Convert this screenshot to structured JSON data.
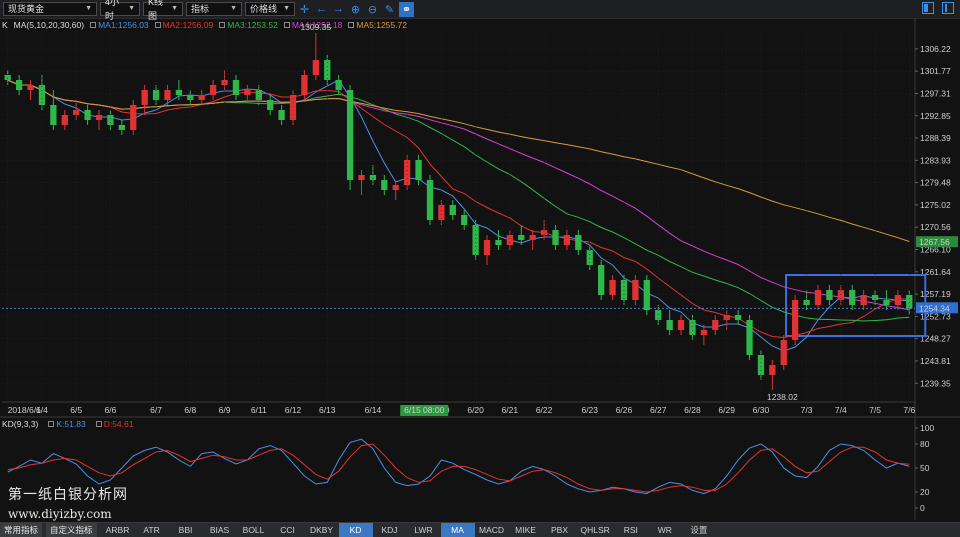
{
  "toolbar": {
    "symbol": "现货黄金",
    "period": "4小时",
    "chart_type": "K线图",
    "indicator": "指标",
    "drawing": "价格线",
    "icons": [
      "crosshair-icon",
      "arrow-left-icon",
      "arrow-right-icon",
      "zoom-in-icon",
      "zoom-out-icon",
      "pen-icon",
      "link-icon"
    ]
  },
  "ma_legend": {
    "mode": "K",
    "label": "MA(5,10,20,30,60)",
    "items": [
      {
        "text": "MA1:1256.03",
        "color": "#4b8fe8"
      },
      {
        "text": "MA2:1256.09",
        "color": "#e23333"
      },
      {
        "text": "MA3:1253.52",
        "color": "#2fb84a"
      },
      {
        "text": "MA4:1252.18",
        "color": "#d63fd6"
      },
      {
        "text": "MA5:1255.72",
        "color": "#d89a3c"
      }
    ]
  },
  "price_axis": {
    "ticks": [
      "1306.22",
      "1301.77",
      "1297.31",
      "1292.85",
      "1288.39",
      "1283.93",
      "1279.48",
      "1275.02",
      "1270.56",
      "1266.10",
      "1261.64",
      "1257.19",
      "1252.73",
      "1248.27",
      "1243.81",
      "1239.35"
    ],
    "last_price_label": "1254.34",
    "ma_price_label": "1267.56"
  },
  "annotations": {
    "high": "1309.35",
    "low": "1238.02",
    "time_cursor": "6/15 08:00"
  },
  "date_axis": [
    "2018/6/1",
    "6/4",
    "6/5",
    "6/6",
    "6/7",
    "6/8",
    "6/9",
    "6/11",
    "6/12",
    "6/13",
    "6/14",
    "6/1",
    "6/19",
    "6/20",
    "6/21",
    "6/22",
    "6/23",
    "6/26",
    "6/27",
    "6/28",
    "6/29",
    "6/30",
    "7/3",
    "7/4",
    "7/5",
    "7/6"
  ],
  "kd_legend": {
    "label": "KD(9,3,3)",
    "k": {
      "text": "K:51.83",
      "color": "#4b8fe8"
    },
    "d": {
      "text": "D:54.61",
      "color": "#e23333"
    }
  },
  "kd_axis": [
    "100",
    "80",
    "50",
    "20",
    "0"
  ],
  "tabs": [
    "常用指标",
    "自定义指标",
    "ARBR",
    "ATR",
    "BBI",
    "BIAS",
    "BOLL",
    "CCI",
    "DKBY",
    "KD",
    "KDJ",
    "LWR",
    "MA",
    "MACD",
    "MIKE",
    "PBX",
    "QHLSR",
    "RSI",
    "WR",
    "设置"
  ],
  "active_tabs": [
    "KD",
    "MA"
  ],
  "watermark": {
    "line1": "第一纸白银分析网",
    "line2": "www.diyizby.com"
  },
  "chart_data": [
    {
      "type": "candlestick",
      "title": "",
      "ylim": [
        1236,
        1310
      ],
      "grid": true,
      "candles_ohlc": [
        [
          1301.0,
          1302.0,
          1299.0,
          1300.0
        ],
        [
          1300.0,
          1301.0,
          1297.0,
          1298.0
        ],
        [
          1298.0,
          1300.0,
          1296.0,
          1299.0
        ],
        [
          1299.0,
          1301.0,
          1294.0,
          1295.0
        ],
        [
          1295.0,
          1298.0,
          1290.0,
          1291.0
        ],
        [
          1291.0,
          1294.0,
          1290.0,
          1293.0
        ],
        [
          1293.0,
          1296.0,
          1292.0,
          1294.0
        ],
        [
          1294.0,
          1295.0,
          1291.0,
          1292.0
        ],
        [
          1292.0,
          1294.0,
          1290.0,
          1293.0
        ],
        [
          1293.0,
          1294.0,
          1290.0,
          1291.0
        ],
        [
          1291.0,
          1292.0,
          1289.0,
          1290.0
        ],
        [
          1290.0,
          1296.0,
          1289.0,
          1295.0
        ],
        [
          1295.0,
          1299.0,
          1293.0,
          1298.0
        ],
        [
          1298.0,
          1299.0,
          1295.0,
          1296.0
        ],
        [
          1296.0,
          1299.0,
          1295.0,
          1298.0
        ],
        [
          1298.0,
          1300.0,
          1296.0,
          1297.0
        ],
        [
          1297.0,
          1298.0,
          1295.0,
          1296.0
        ],
        [
          1296.0,
          1298.0,
          1295.0,
          1297.0
        ],
        [
          1297.0,
          1300.0,
          1296.0,
          1299.0
        ],
        [
          1299.0,
          1302.0,
          1298.0,
          1300.0
        ],
        [
          1300.0,
          1301.0,
          1296.0,
          1297.0
        ],
        [
          1297.0,
          1299.0,
          1296.0,
          1298.0
        ],
        [
          1298.0,
          1299.0,
          1295.0,
          1296.0
        ],
        [
          1296.0,
          1297.0,
          1293.0,
          1294.0
        ],
        [
          1294.0,
          1295.0,
          1291.0,
          1292.0
        ],
        [
          1292.0,
          1298.0,
          1291.0,
          1297.0
        ],
        [
          1297.0,
          1302.0,
          1296.0,
          1301.0
        ],
        [
          1301.0,
          1309.4,
          1300.0,
          1304.0
        ],
        [
          1304.0,
          1305.0,
          1299.0,
          1300.0
        ],
        [
          1300.0,
          1301.0,
          1297.0,
          1298.0
        ],
        [
          1298.0,
          1299.0,
          1278.0,
          1280.0
        ],
        [
          1280.0,
          1282.0,
          1277.0,
          1281.0
        ],
        [
          1281.0,
          1283.0,
          1279.0,
          1280.0
        ],
        [
          1280.0,
          1281.0,
          1277.0,
          1278.0
        ],
        [
          1278.0,
          1280.0,
          1276.0,
          1279.0
        ],
        [
          1279.0,
          1285.0,
          1278.0,
          1284.0
        ],
        [
          1284.0,
          1285.0,
          1279.0,
          1280.0
        ],
        [
          1280.0,
          1281.0,
          1271.0,
          1272.0
        ],
        [
          1272.0,
          1276.0,
          1271.0,
          1275.0
        ],
        [
          1275.0,
          1276.0,
          1272.0,
          1273.0
        ],
        [
          1273.0,
          1274.0,
          1270.0,
          1271.0
        ],
        [
          1271.0,
          1272.0,
          1264.0,
          1265.0
        ],
        [
          1265.0,
          1269.0,
          1263.0,
          1268.0
        ],
        [
          1268.0,
          1270.0,
          1266.0,
          1267.0
        ],
        [
          1267.0,
          1270.0,
          1266.0,
          1269.0
        ],
        [
          1269.0,
          1271.0,
          1267.0,
          1268.0
        ],
        [
          1268.0,
          1270.0,
          1266.0,
          1269.0
        ],
        [
          1269.0,
          1272.0,
          1268.0,
          1270.0
        ],
        [
          1270.0,
          1271.0,
          1266.0,
          1267.0
        ],
        [
          1267.0,
          1270.0,
          1266.0,
          1269.0
        ],
        [
          1269.0,
          1270.0,
          1265.0,
          1266.0
        ],
        [
          1266.0,
          1267.0,
          1262.0,
          1263.0
        ],
        [
          1263.0,
          1264.0,
          1256.0,
          1257.0
        ],
        [
          1257.0,
          1261.0,
          1256.0,
          1260.0
        ],
        [
          1260.0,
          1261.0,
          1255.0,
          1256.0
        ],
        [
          1256.0,
          1261.0,
          1255.0,
          1260.0
        ],
        [
          1260.0,
          1261.0,
          1253.0,
          1254.0
        ],
        [
          1254.0,
          1255.0,
          1251.0,
          1252.0
        ],
        [
          1252.0,
          1254.0,
          1249.0,
          1250.0
        ],
        [
          1250.0,
          1253.0,
          1249.0,
          1252.0
        ],
        [
          1252.0,
          1253.0,
          1248.0,
          1249.0
        ],
        [
          1249.0,
          1251.0,
          1247.0,
          1250.0
        ],
        [
          1250.0,
          1253.0,
          1249.0,
          1252.0
        ],
        [
          1252.0,
          1254.0,
          1250.0,
          1253.0
        ],
        [
          1253.0,
          1254.0,
          1251.0,
          1252.0
        ],
        [
          1252.0,
          1253.0,
          1244.0,
          1245.0
        ],
        [
          1245.0,
          1246.0,
          1240.0,
          1241.0
        ],
        [
          1241.0,
          1244.0,
          1238.0,
          1243.0
        ],
        [
          1243.0,
          1249.0,
          1242.0,
          1248.0
        ],
        [
          1248.0,
          1257.0,
          1247.0,
          1256.0
        ],
        [
          1256.0,
          1258.0,
          1254.0,
          1255.0
        ],
        [
          1255.0,
          1259.0,
          1254.0,
          1258.0
        ],
        [
          1258.0,
          1259.0,
          1255.0,
          1256.0
        ],
        [
          1256.0,
          1259.0,
          1255.0,
          1258.0
        ],
        [
          1258.0,
          1259.0,
          1254.0,
          1255.0
        ],
        [
          1255.0,
          1258.0,
          1254.0,
          1257.0
        ],
        [
          1257.0,
          1258.0,
          1255.0,
          1256.0
        ],
        [
          1256.0,
          1258.0,
          1254.0,
          1255.0
        ],
        [
          1255.0,
          1258.0,
          1254.0,
          1257.0
        ],
        [
          1257.0,
          1258.0,
          1253.0,
          1254.3
        ]
      ],
      "moving_averages": [
        {
          "name": "MA1",
          "period": 5
        },
        {
          "name": "MA2",
          "period": 10
        },
        {
          "name": "MA3",
          "period": 20
        },
        {
          "name": "MA4",
          "period": 30
        },
        {
          "name": "MA5",
          "period": 60
        }
      ],
      "highlight_range": {
        "from_candle": 69,
        "to_candle": 79,
        "price_from": 1252.0,
        "price_to": 1261.0
      }
    },
    {
      "type": "line",
      "title": "KD(9,3,3)",
      "ylim": [
        0,
        100
      ],
      "series": [
        {
          "name": "K",
          "values": [
            45,
            52,
            60,
            56,
            68,
            62,
            55,
            40,
            30,
            35,
            50,
            65,
            72,
            76,
            70,
            60,
            52,
            68,
            70,
            62,
            55,
            60,
            74,
            78,
            72,
            56,
            40,
            30,
            32,
            60,
            82,
            86,
            74,
            50,
            32,
            28,
            30,
            40,
            60,
            56,
            48,
            42,
            35,
            30,
            34,
            46,
            52,
            48,
            40,
            30,
            24,
            20,
            22,
            26,
            24,
            20,
            18,
            26,
            32,
            30,
            22,
            18,
            24,
            40,
            60,
            75,
            80,
            70,
            50,
            40,
            38,
            52,
            72,
            80,
            78,
            72,
            60,
            50,
            56,
            52
          ]
        },
        {
          "name": "D",
          "values": [
            48,
            50,
            54,
            56,
            60,
            62,
            60,
            52,
            44,
            40,
            44,
            54,
            62,
            70,
            72,
            66,
            58,
            62,
            66,
            64,
            60,
            60,
            66,
            72,
            74,
            66,
            54,
            42,
            36,
            46,
            64,
            78,
            80,
            66,
            50,
            38,
            32,
            34,
            46,
            52,
            52,
            48,
            42,
            36,
            34,
            40,
            46,
            48,
            44,
            38,
            30,
            24,
            22,
            24,
            24,
            22,
            20,
            22,
            26,
            28,
            26,
            22,
            22,
            30,
            44,
            60,
            72,
            74,
            64,
            52,
            44,
            46,
            58,
            70,
            76,
            76,
            70,
            60,
            56,
            54.6
          ]
        }
      ]
    }
  ]
}
